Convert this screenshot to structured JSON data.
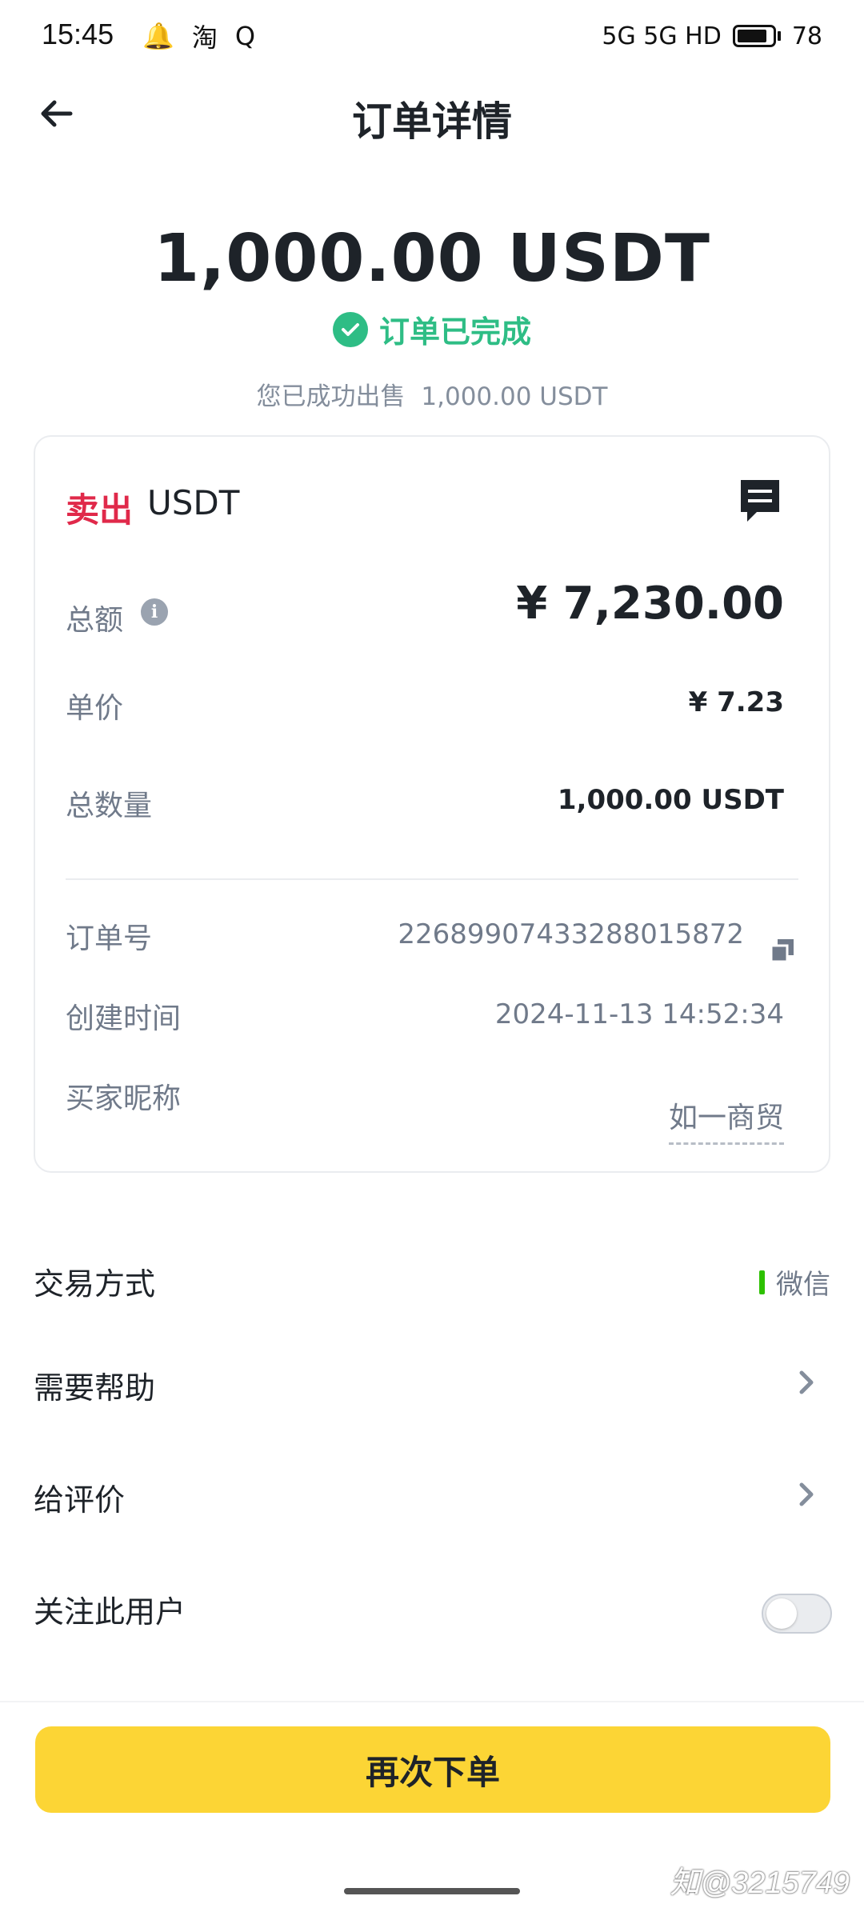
{
  "status_bar": {
    "time": "15:45",
    "app_icons": [
      "qq-icon",
      "taobao-icon",
      "q-icon"
    ],
    "app_glyphs": [
      "🔔",
      "淘",
      "Q"
    ],
    "network": "5G 5G HD",
    "battery": "78"
  },
  "header": {
    "title": "订单详情",
    "back_icon": "arrow-left-icon"
  },
  "hero": {
    "amount": "1,000.00 USDT",
    "status": "订单已完成",
    "sub_label": "您已成功出售",
    "sub_amount": "1,000.00 USDT",
    "status_color": "#2ebd85"
  },
  "card": {
    "side": "卖出",
    "coin": "USDT",
    "side_color": "#e0294a",
    "rows": {
      "total_label": "总额",
      "total_value": "¥ 7,230.00",
      "price_label": "单价",
      "price_value": "¥ 7.23",
      "qty_label": "总数量",
      "qty_value": "1,000.00 USDT",
      "order_no_label": "订单号",
      "order_no_value": "22689907433288015872",
      "created_label": "创建时间",
      "created_value": "2024-11-13 14:52:34",
      "buyer_label": "买家昵称",
      "buyer_value": "如一商贸"
    }
  },
  "list": {
    "payment_label": "交易方式",
    "payment_value": "微信",
    "payment_color": "#2dc100",
    "help_label": "需要帮助",
    "review_label": "给评价",
    "follow_label": "关注此用户",
    "follow_enabled": false
  },
  "cta": {
    "label": "再次下单",
    "color": "#fcd535"
  },
  "watermark": "知@3215749"
}
